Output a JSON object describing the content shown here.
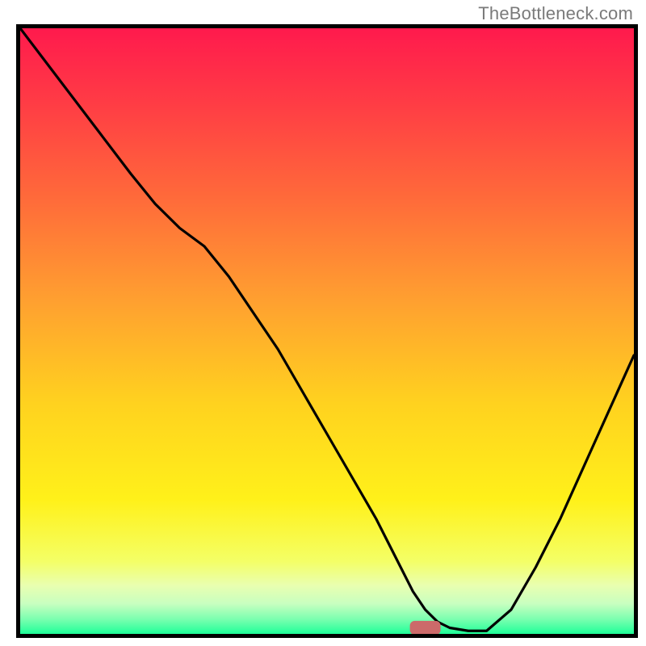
{
  "attribution": "TheBottleneck.com",
  "colors": {
    "frame": "#000000",
    "curve": "#000000",
    "marker": "#cc6a6a",
    "attribution_text": "#7a7a7a"
  },
  "chart_data": {
    "type": "line",
    "title": "",
    "xlabel": "",
    "ylabel": "",
    "xlim": [
      0,
      100
    ],
    "ylim": [
      0,
      100
    ],
    "grid": false,
    "legend": false,
    "gradient_stops": [
      {
        "offset": 0.0,
        "color": "#ff1a4d"
      },
      {
        "offset": 0.12,
        "color": "#ff3b45"
      },
      {
        "offset": 0.28,
        "color": "#ff6a3a"
      },
      {
        "offset": 0.45,
        "color": "#ffa030"
      },
      {
        "offset": 0.62,
        "color": "#ffd21f"
      },
      {
        "offset": 0.78,
        "color": "#fff11a"
      },
      {
        "offset": 0.88,
        "color": "#f4ff66"
      },
      {
        "offset": 0.92,
        "color": "#e9ffb0"
      },
      {
        "offset": 0.95,
        "color": "#c8ffc0"
      },
      {
        "offset": 0.975,
        "color": "#7dffb0"
      },
      {
        "offset": 1.0,
        "color": "#1fff99"
      }
    ],
    "series": [
      {
        "name": "bottleneck_curve",
        "x": [
          0,
          6,
          12,
          18,
          22,
          26,
          30,
          34,
          38,
          42,
          46,
          50,
          54,
          58,
          62,
          64,
          66,
          68,
          70,
          73,
          76,
          80,
          84,
          88,
          92,
          96,
          100
        ],
        "y": [
          100,
          92,
          84,
          76,
          71,
          67,
          64,
          59,
          53,
          47,
          40,
          33,
          26,
          19,
          11,
          7,
          4,
          2,
          1,
          0.5,
          0.5,
          4,
          11,
          19,
          28,
          37,
          46
        ]
      }
    ],
    "marker": {
      "x_center": 66,
      "y_center": 1,
      "width_x_units": 5,
      "height_y_units": 2.3,
      "rx": 6
    }
  }
}
